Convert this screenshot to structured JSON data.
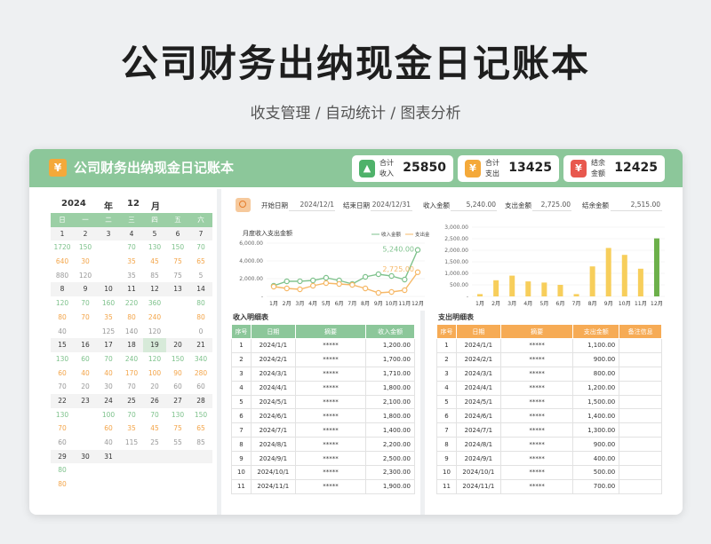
{
  "hero": {
    "title": "公司财务出纳现金日记账本",
    "subtitle": "收支管理 / 自动统计 / 图表分析"
  },
  "header": {
    "title": "公司财务出纳现金日记账本",
    "logo_glyph": "¥",
    "kpis": [
      {
        "label1": "合计",
        "label2": "收入",
        "value": "25850",
        "color": "#4fb26a",
        "glyph": "▲"
      },
      {
        "label1": "合计",
        "label2": "支出",
        "value": "13425",
        "color": "#f4a93a",
        "glyph": "¥"
      },
      {
        "label1": "结余",
        "label2": "金额",
        "value": "12425",
        "color": "#e8584e",
        "glyph": "¥"
      }
    ]
  },
  "calendar": {
    "year": "2024",
    "year_label": "年",
    "month": "12",
    "month_label": "月",
    "weekdays": [
      "日",
      "一",
      "二",
      "三",
      "四",
      "五",
      "六"
    ],
    "weeks": [
      {
        "dates": [
          "",
          "",
          "",
          "",
          "",
          "",
          ""
        ],
        "rows": [
          [
            "",
            "",
            "",
            "",
            "",
            "",
            ""
          ],
          [
            "",
            "",
            "",
            "",
            "",
            "",
            ""
          ],
          [
            "",
            "",
            "",
            "",
            "",
            "",
            ""
          ],
          [
            "",
            "",
            "",
            "",
            "",
            "",
            ""
          ]
        ]
      }
    ]
  },
  "filter": {
    "start_label": "开始日期",
    "start_value": "2024/12/1",
    "end_label": "结束日期",
    "end_value": "2024/12/31",
    "income_label": "收入金额",
    "income_value": "5,240.00",
    "expense_label": "支出金额",
    "expense_value": "2,725.00",
    "balance_label": "结余金额",
    "balance_value": "2,515.00"
  },
  "chart_data": [
    {
      "type": "line",
      "title": "月度收入支出金额",
      "x": [
        "1月",
        "2月",
        "3月",
        "4月",
        "5月",
        "6月",
        "7月",
        "8月",
        "9月",
        "10月",
        "11月",
        "12月"
      ],
      "series": [
        {
          "name": "收入金额",
          "color": "#7ec28c",
          "values": [
            1200,
            1700,
            1710,
            1800,
            2100,
            1800,
            1400,
            2200,
            2500,
            2300,
            1900,
            5240
          ]
        },
        {
          "name": "支出金额",
          "color": "#f6b867",
          "values": [
            1100,
            900,
            800,
            1200,
            1500,
            1400,
            1300,
            900,
            400,
            500,
            700,
            2725
          ]
        }
      ],
      "annotations": [
        "5,240.00",
        "2,725.00"
      ],
      "ylim": [
        0,
        6000
      ],
      "yticks": [
        "-",
        "2,000.00",
        "4,000.00",
        "6,000.00"
      ]
    },
    {
      "type": "bar",
      "x": [
        "1月",
        "2月",
        "3月",
        "4月",
        "5月",
        "6月",
        "7月",
        "8月",
        "9月",
        "10月",
        "11月",
        "12月"
      ],
      "values": [
        100,
        700,
        900,
        650,
        600,
        500,
        100,
        1300,
        2100,
        1800,
        1200,
        2515
      ],
      "ylim": [
        0,
        3000
      ],
      "yticks": [
        "-",
        "500.00",
        "1,000.00",
        "1,500.00",
        "2,000.00",
        "2,500.00",
        "3,000.00"
      ],
      "colors": {
        "normal": "#f7ce5b",
        "highlight": "#6cb04a"
      }
    }
  ],
  "income_table": {
    "title": "收入明细表",
    "headers": [
      "序号",
      "日期",
      "摘要",
      "收入金额"
    ],
    "rows": [
      [
        "1",
        "2024/1/1",
        "*****",
        "1,200.00"
      ],
      [
        "2",
        "2024/2/1",
        "*****",
        "1,700.00"
      ],
      [
        "3",
        "2024/3/1",
        "*****",
        "1,710.00"
      ],
      [
        "4",
        "2024/4/1",
        "*****",
        "1,800.00"
      ],
      [
        "5",
        "2024/5/1",
        "*****",
        "2,100.00"
      ],
      [
        "6",
        "2024/6/1",
        "*****",
        "1,800.00"
      ],
      [
        "7",
        "2024/7/1",
        "*****",
        "1,400.00"
      ],
      [
        "8",
        "2024/8/1",
        "*****",
        "2,200.00"
      ],
      [
        "9",
        "2024/9/1",
        "*****",
        "2,500.00"
      ],
      [
        "10",
        "2024/10/1",
        "*****",
        "2,300.00"
      ],
      [
        "11",
        "2024/11/1",
        "*****",
        "1,900.00"
      ]
    ]
  },
  "expense_table": {
    "title": "支出明细表",
    "headers": [
      "序号",
      "日期",
      "摘要",
      "支出金额",
      "备注信息"
    ],
    "rows": [
      [
        "1",
        "2024/1/1",
        "*****",
        "1,100.00",
        ""
      ],
      [
        "2",
        "2024/2/1",
        "*****",
        "900.00",
        ""
      ],
      [
        "3",
        "2024/3/1",
        "*****",
        "800.00",
        ""
      ],
      [
        "4",
        "2024/4/1",
        "*****",
        "1,200.00",
        ""
      ],
      [
        "5",
        "2024/5/1",
        "*****",
        "1,500.00",
        ""
      ],
      [
        "6",
        "2024/6/1",
        "*****",
        "1,400.00",
        ""
      ],
      [
        "7",
        "2024/7/1",
        "*****",
        "1,300.00",
        ""
      ],
      [
        "8",
        "2024/8/1",
        "*****",
        "900.00",
        ""
      ],
      [
        "9",
        "2024/9/1",
        "*****",
        "400.00",
        ""
      ],
      [
        "10",
        "2024/10/1",
        "*****",
        "500.00",
        ""
      ],
      [
        "11",
        "2024/11/1",
        "*****",
        "700.00",
        ""
      ]
    ]
  }
}
